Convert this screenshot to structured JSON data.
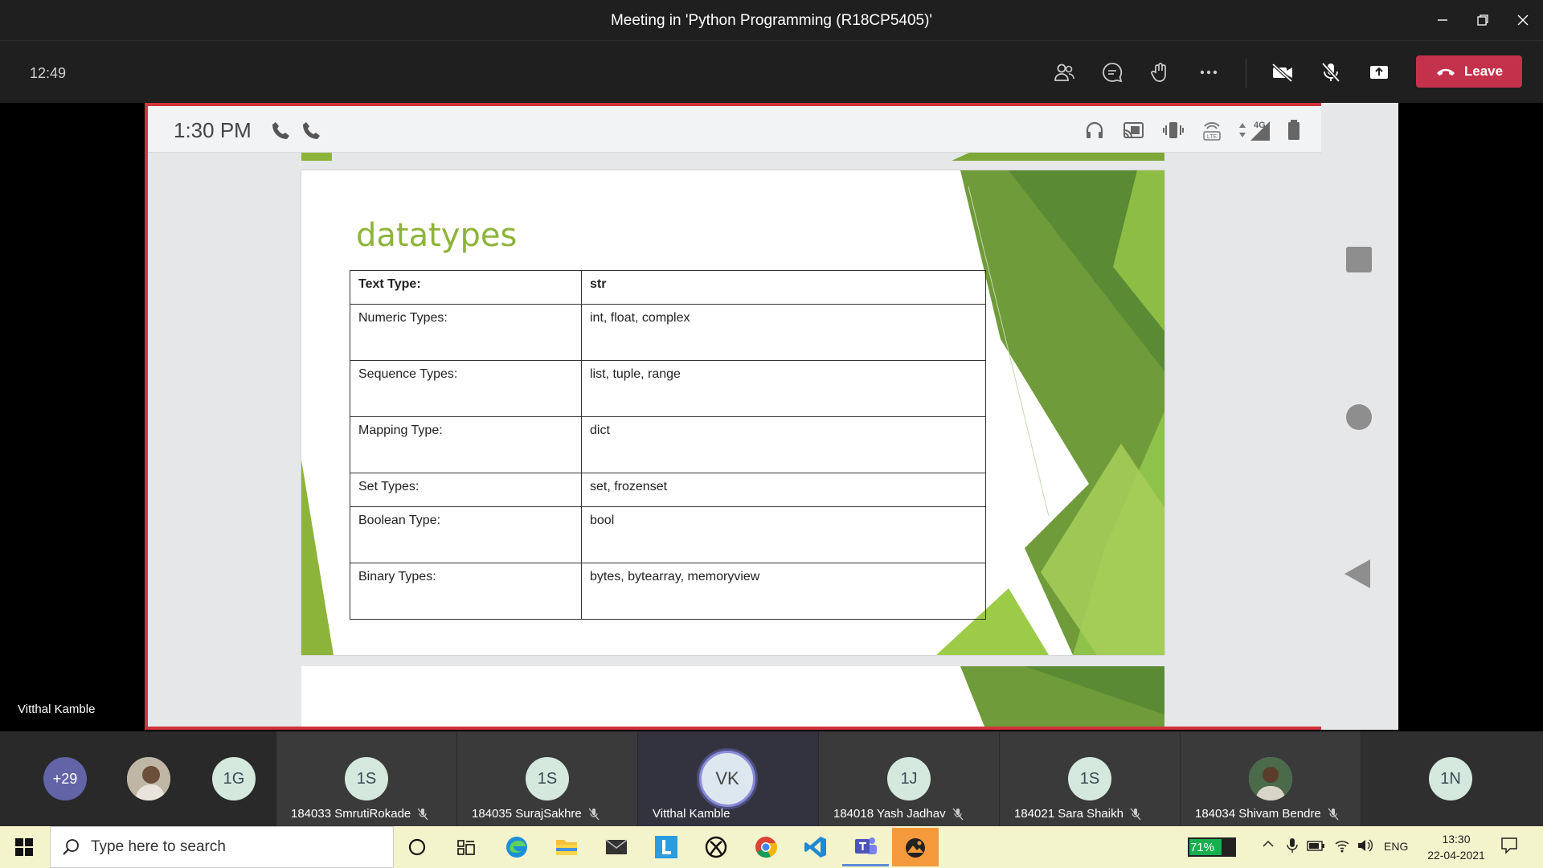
{
  "window": {
    "title": "Meeting in 'Python Programming (R18CP5405)'"
  },
  "toolbar": {
    "elapsed": "12:49",
    "leave_label": "Leave"
  },
  "phone_status": {
    "time": "1:30 PM",
    "network": "4G"
  },
  "slide": {
    "title": "datatypes",
    "rows": [
      {
        "key": "Text Type:",
        "value": "str"
      },
      {
        "key": "Numeric Types:",
        "value": "int, float, complex"
      },
      {
        "key": "Sequence Types:",
        "value": "list, tuple, range"
      },
      {
        "key": "Mapping Type:",
        "value": "dict"
      },
      {
        "key": "Set Types:",
        "value": "set, frozenset"
      },
      {
        "key": "Boolean Type:",
        "value": "bool"
      },
      {
        "key": "Binary Types:",
        "value": "bytes, bytearray, memoryview"
      }
    ]
  },
  "presenter": "Vitthal Kamble",
  "participants": {
    "more": "+29",
    "tiles": [
      {
        "initials": "1G"
      },
      {
        "initials": "1S",
        "name": "184033 SmrutiRokade"
      },
      {
        "initials": "1S",
        "name": "184035 SurajSakhre"
      },
      {
        "initials": "VK",
        "name": "Vitthal Kamble"
      },
      {
        "initials": "1J",
        "name": "184018 Yash Jadhav"
      },
      {
        "initials": "1S",
        "name": "184021 Sara Shaikh"
      },
      {
        "initials": "",
        "name": "184034 Shivam Bendre"
      },
      {
        "initials": "1N"
      }
    ]
  },
  "taskbar": {
    "search_placeholder": "Type here to search",
    "battery": "71%",
    "battery_level": 0.71,
    "language": "ENG",
    "time": "13:30",
    "date": "22-04-2021"
  },
  "colors": {
    "leave": "#c4314b",
    "share_border": "#d1343a",
    "slide_title": "#8db43a",
    "accent": "#6264a7"
  }
}
